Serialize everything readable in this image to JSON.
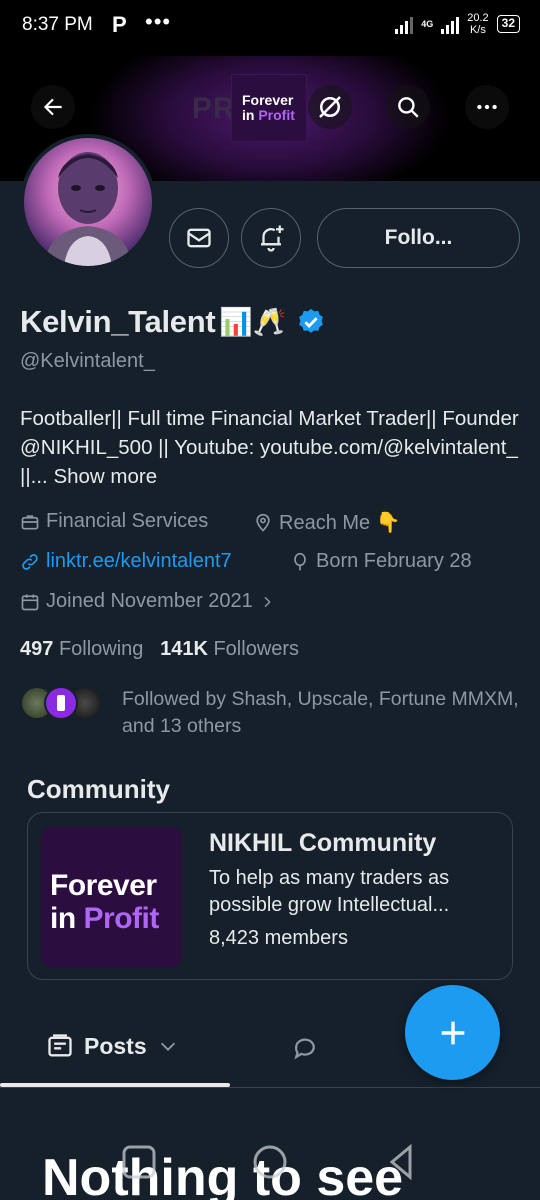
{
  "status_bar": {
    "time": "8:37 PM",
    "app_icon": "P",
    "dots": "•••",
    "network": "4G",
    "speed_value": "20.2",
    "speed_unit": "K/s",
    "battery": "32"
  },
  "banner": {
    "text_faded": "PR",
    "logo_line1": "Forever",
    "logo_line2_a": "in",
    "logo_line2_b": "Profit"
  },
  "profile": {
    "name": "Kelvin_Talent",
    "name_emojis": "📊🥂",
    "handle": "@Kelvintalent_",
    "follow_label": "Follo...",
    "bio_text": "Footballer|| Full time Financial Market Trader|| Founder @NIKHIL_500 || Youtube: youtube.com/@kelvintalent_ ||...",
    "bio_more": "Show more",
    "category": "Financial Services",
    "location": "Reach Me 👇",
    "website": "linktr.ee/kelvintalent7",
    "birthday": "Born February 28",
    "joined": "Joined November 2021",
    "following_count": "497",
    "following_label": "Following",
    "followers_count": "141K",
    "followers_label": "Followers",
    "followed_by": "Followed by Shash, Upscale, Fortune MMXM, and 13 others"
  },
  "community": {
    "heading": "Community",
    "logo_line1": "Forever",
    "logo_line2_a": "in",
    "logo_line2_b": "Profit",
    "title": "NIKHIL Community",
    "description": "To help as many traders as possible grow Intellectual...",
    "members": "8,423 members"
  },
  "tabs": {
    "posts": "Posts"
  },
  "empty_state": {
    "title": "Nothing to see"
  },
  "colors": {
    "background": "#15202b",
    "accent": "#1d9bf0",
    "secondary_text": "#8b98a5",
    "border": "#38444d"
  }
}
